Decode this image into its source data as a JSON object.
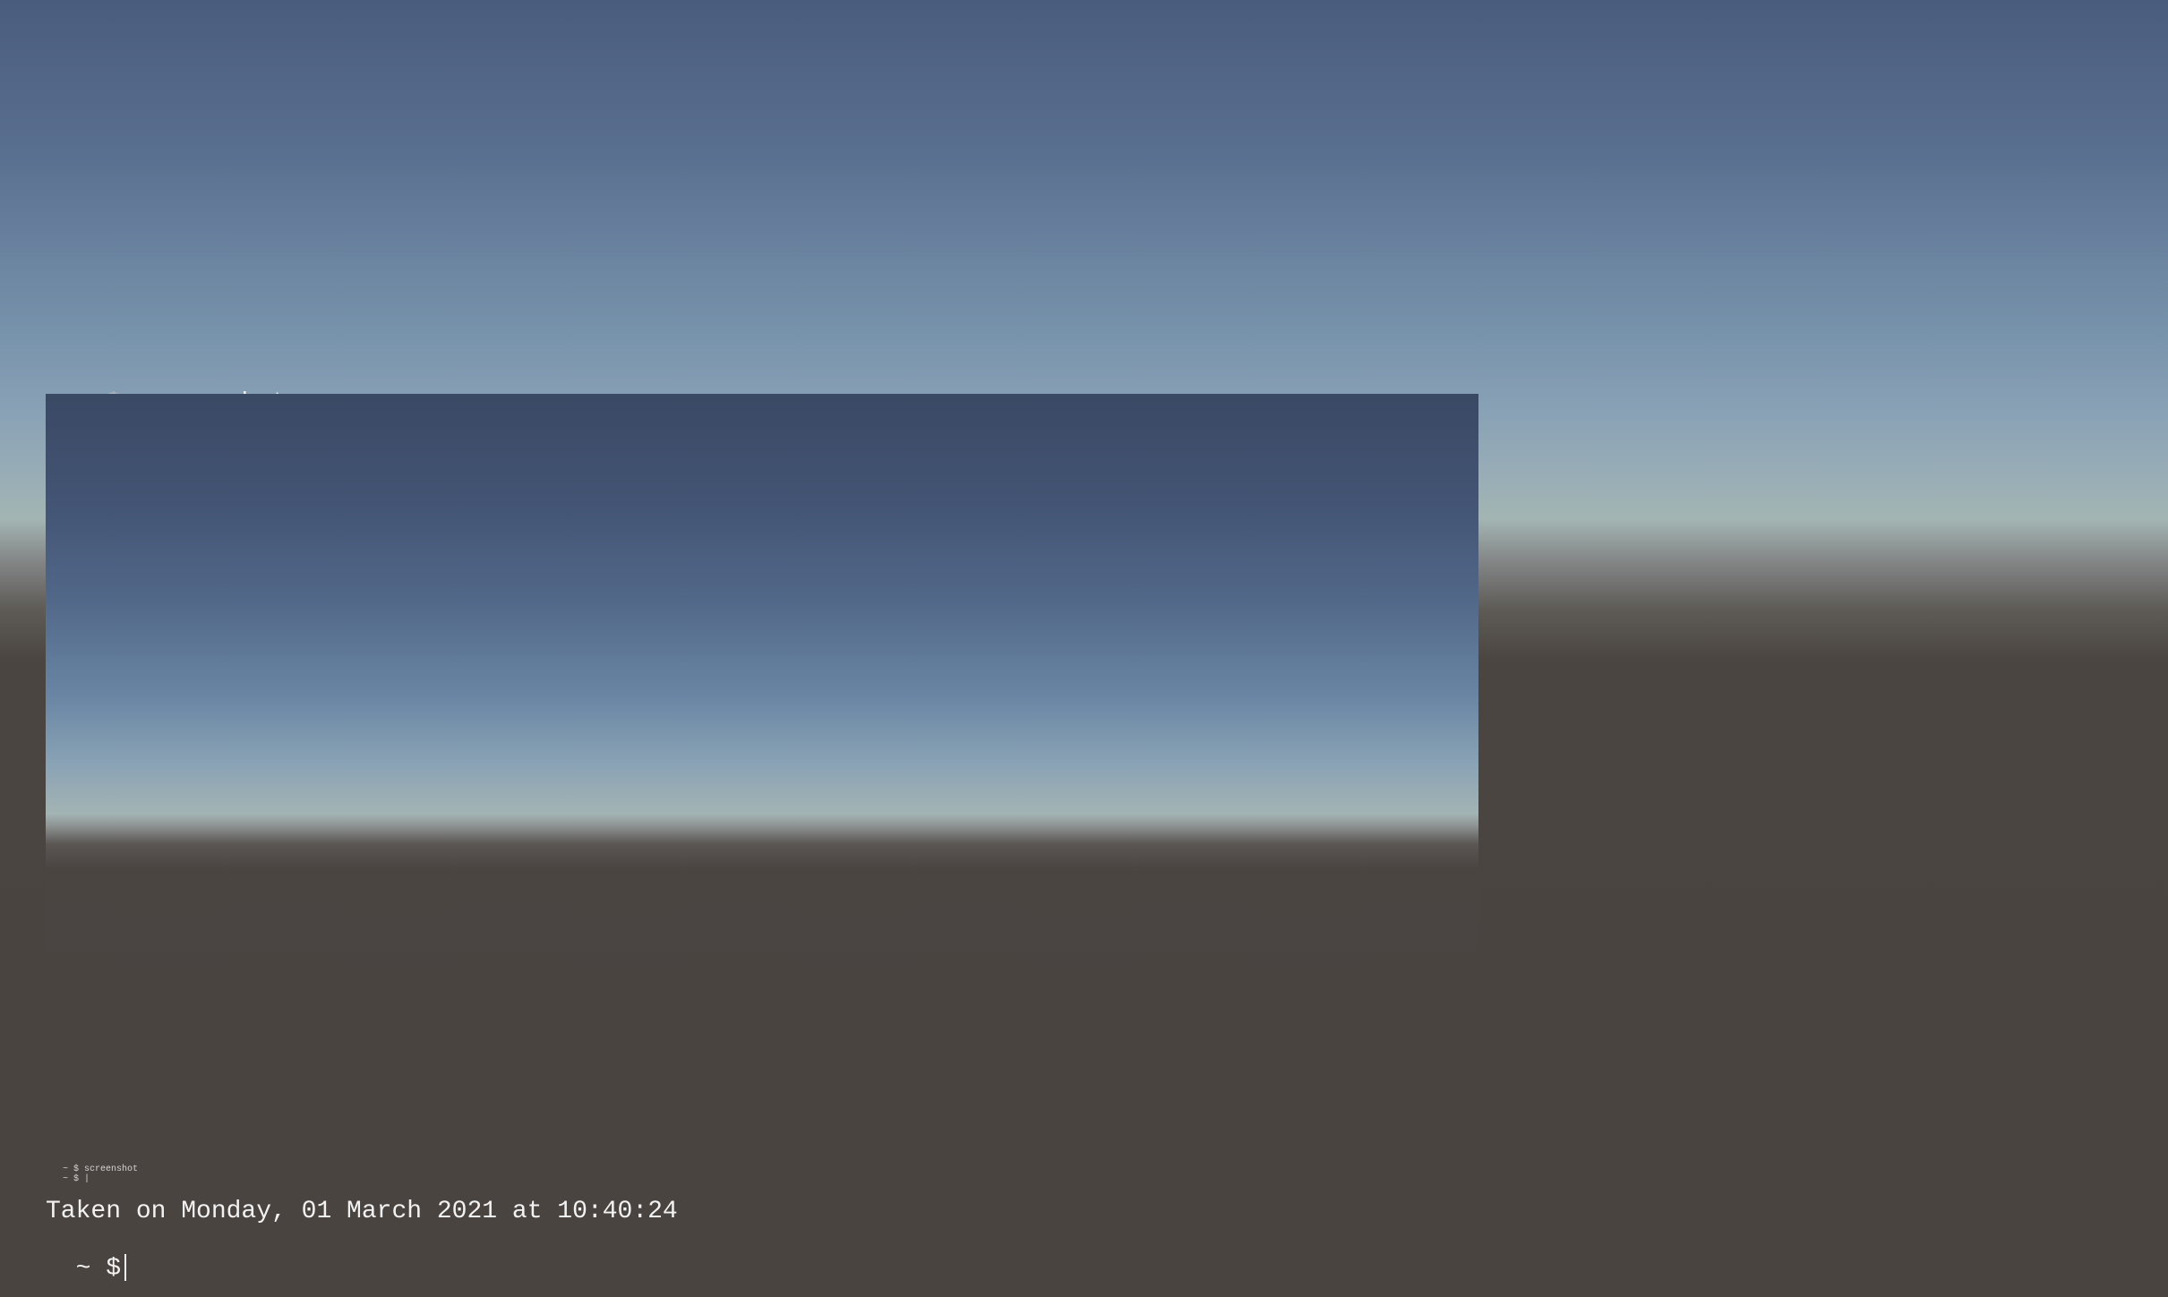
{
  "terminal": {
    "prompt_symbol": "~ $",
    "command": "screenshot",
    "caption": "Taken on Monday, 01 March 2021 at 10:40:24",
    "mini_line1": "~ $ screenshot",
    "mini_line2": "~ $ |"
  },
  "colors": {
    "sky_top": "#4a5c7e",
    "horizon": "#a3b5b3",
    "ground": "#4a4441",
    "text": "#f2f2f2"
  }
}
